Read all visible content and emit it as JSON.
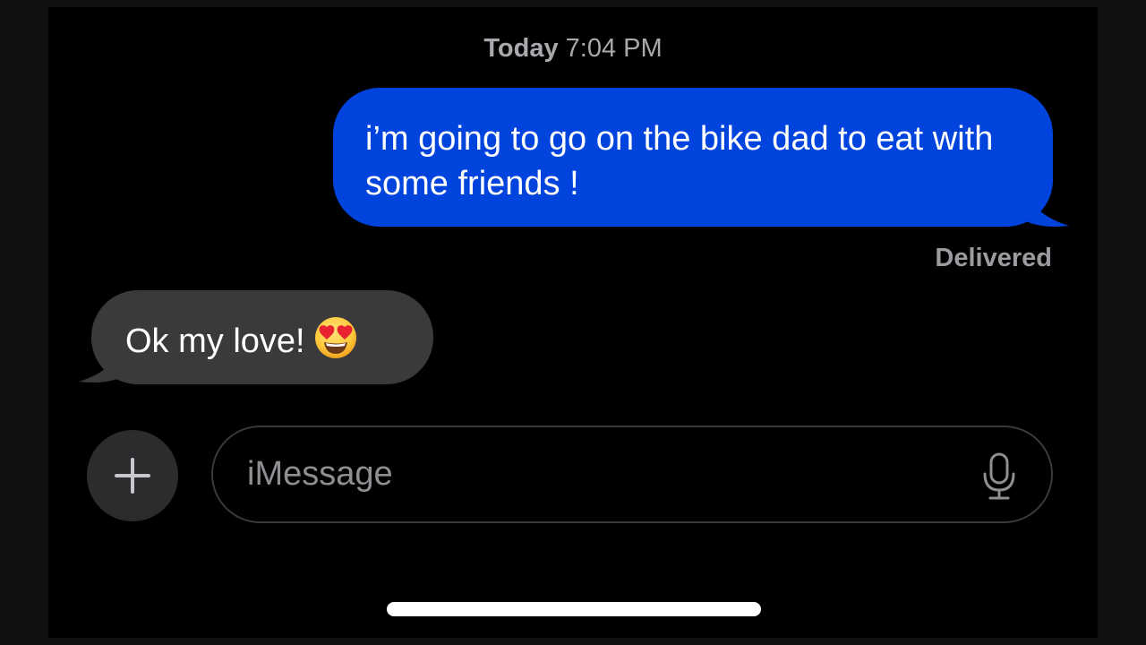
{
  "header": {
    "timestamp_day": "Today",
    "timestamp_time": "7:04 PM"
  },
  "messages": [
    {
      "direction": "sent",
      "text": "i’m going to go on the bike dad to eat with some friends !",
      "color": "#0044dd"
    },
    {
      "direction": "received",
      "text": "Ok my love!",
      "emoji": "smiling-face-with-heart-eyes",
      "color": "#3a3a3c"
    }
  ],
  "status": {
    "delivered_label": "Delivered"
  },
  "composer": {
    "placeholder": "iMessage",
    "plus_icon": "plus-icon",
    "mic_icon": "microphone-icon"
  }
}
